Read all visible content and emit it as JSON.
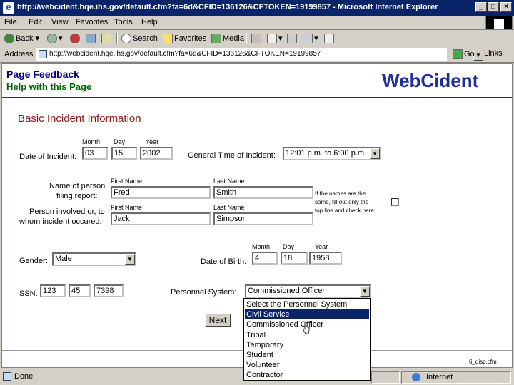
{
  "window": {
    "title": "http://webcident.hqe.ihs.gov/default.cfm?fa=6d&CFID=136126&CFTOKEN=19199857 - Microsoft Internet Explorer",
    "minimize": "_",
    "maximize": "□",
    "close": "×"
  },
  "menu": {
    "file": "File",
    "edit": "Edit",
    "view": "View",
    "favorites": "Favorites",
    "tools": "Tools",
    "help": "Help"
  },
  "toolbar": {
    "back": "Back",
    "search": "Search",
    "favorites": "Favorites",
    "media": "Media"
  },
  "address": {
    "label": "Address",
    "url": "http://webcident.hqe.ihs.gov/default.cfm?fa=6d&CFID=136126&CFTOKEN=19199857",
    "go": "Go",
    "links": "Links"
  },
  "page": {
    "feedback_link": "Page Feedback",
    "help_link": "Help with this Page",
    "brand": "WebCident",
    "section_title": "Basic Incident Information",
    "date_of_incident": {
      "label": "Date of Incident:",
      "month_label": "Month",
      "day_label": "Day",
      "year_label": "Year",
      "month": "03",
      "day": "15",
      "year": "2002"
    },
    "general_time": {
      "label": "General Time of Incident:",
      "value": "12:01 p.m. to 6:00 p.m."
    },
    "filer": {
      "label_line1": "Name of person",
      "label_line2": "filing report:",
      "first_label": "First Name",
      "last_label": "Last Name",
      "first": "Fred",
      "last": "Smith"
    },
    "involved": {
      "label_line1": "Person involved or, to",
      "label_line2": "whom incident occured:",
      "first_label": "First Name",
      "last_label": "Last Name",
      "first": "Jack",
      "last": "Simpson"
    },
    "same_note": {
      "line1": "If the names are the",
      "line2": "same, fill out only the",
      "line3": "top line and check here"
    },
    "gender": {
      "label": "Gender:",
      "value": "Male"
    },
    "dob": {
      "label": "Date of Birth:",
      "month_label": "Month",
      "day_label": "Day",
      "year_label": "Year",
      "month": "4",
      "day": "18",
      "year": "1958"
    },
    "ssn": {
      "label": "SSN:",
      "part1": "123",
      "part2": "45",
      "part3": "7398"
    },
    "personnel_system": {
      "label": "Personnel System:",
      "value": "Commissioned Officer",
      "options": [
        "Select the Personnel System",
        "Civil Service",
        "Commissioned Officer",
        "Tribal",
        "Temporary",
        "Student",
        "Volunteer",
        "Contractor"
      ],
      "highlighted_index": 1
    },
    "next_button": "Next",
    "page_id": "6_disp.cfm"
  },
  "status": {
    "text": "Done",
    "zone": "Internet"
  }
}
